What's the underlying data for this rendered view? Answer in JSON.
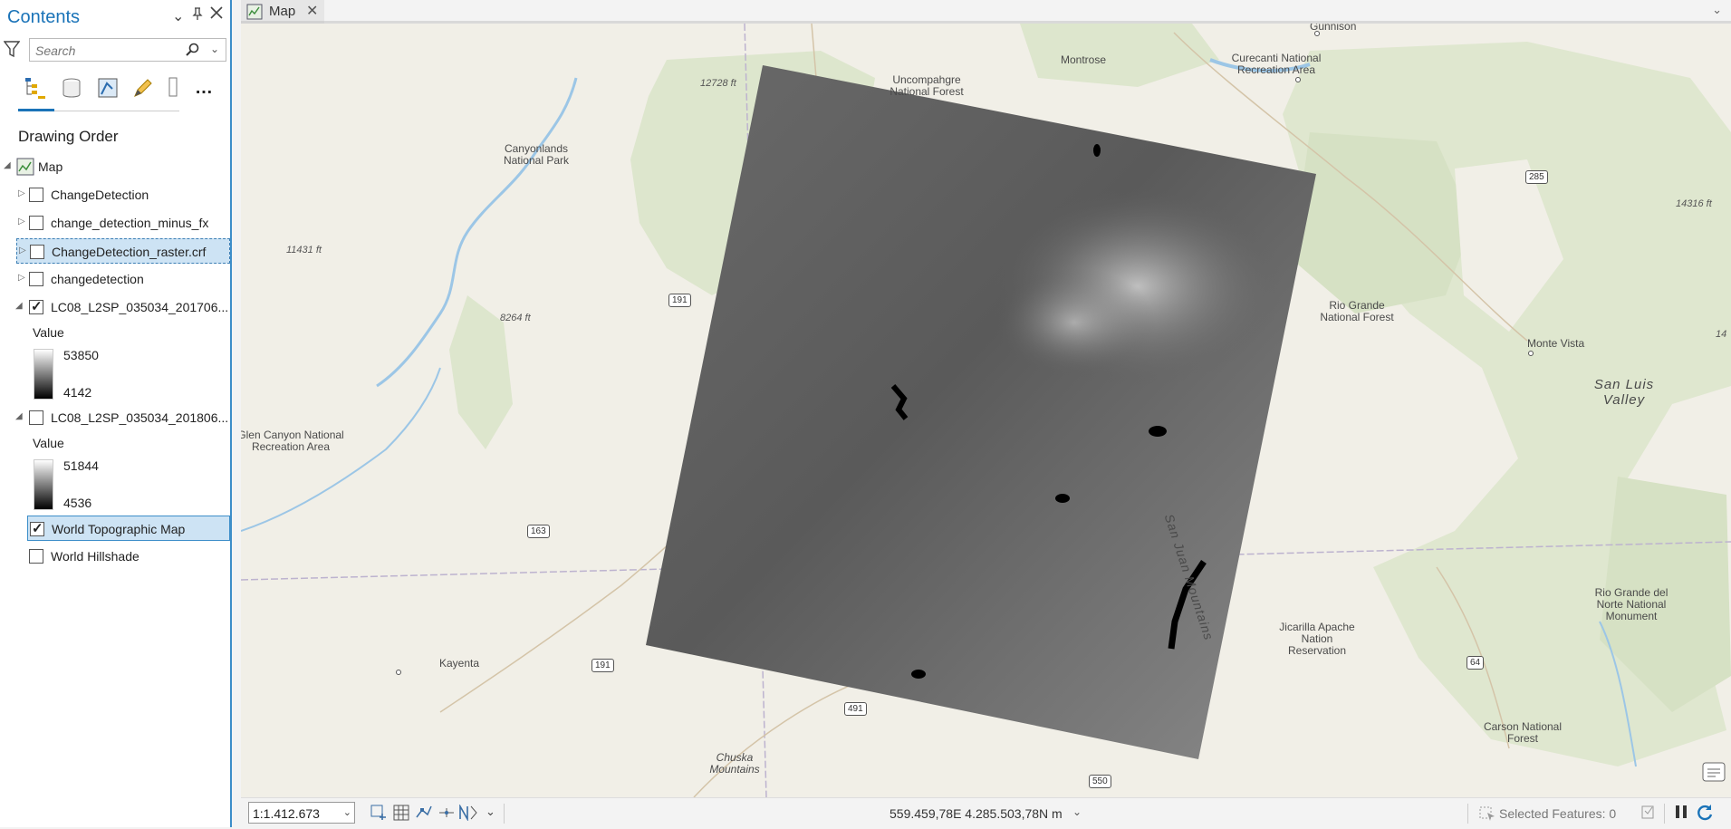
{
  "contents": {
    "title": "Contents",
    "search_placeholder": "Search",
    "section": "Drawing Order",
    "map_label": "Map",
    "layers": [
      {
        "name": "ChangeDetection",
        "checked": false
      },
      {
        "name": "change_detection_minus_fx",
        "checked": false
      },
      {
        "name": "ChangeDetection_raster.crf",
        "checked": false
      },
      {
        "name": "changedetection",
        "checked": false
      },
      {
        "name": "LC08_L2SP_035034_201706...",
        "checked": true,
        "legend_title": "Value",
        "max": "53850",
        "min": "4142"
      },
      {
        "name": "LC08_L2SP_035034_201806...",
        "checked": false,
        "legend_title": "Value",
        "max": "51844",
        "min": "4536"
      },
      {
        "name": "World Topographic Map",
        "checked": true
      },
      {
        "name": "World Hillshade",
        "checked": false
      }
    ]
  },
  "tab": {
    "label": "Map"
  },
  "map": {
    "places": [
      "Gunnison",
      "Montrose",
      "Curecanti National Recreation Area",
      "Uncompahgre National Forest",
      "Canyonlands National Park",
      "Rio Grande National Forest",
      "Monte Vista",
      "San Luis Valley",
      "Glen Canyon National Recreation Area",
      "San Juan Mountains",
      "Jicarilla Apache Nation Reservation",
      "Rio Grande del Norte National Monument",
      "Kayenta",
      "Chuska Mountains",
      "Carson National Forest"
    ],
    "elevations": [
      "12728 ft",
      "11431 ft",
      "8264 ft",
      "14316 ft",
      "14"
    ],
    "routes": [
      "285",
      "191",
      "163",
      "191",
      "491",
      "64",
      "550"
    ]
  },
  "status": {
    "scale": "1:1.412.673",
    "coordinates": "559.459,78E 4.285.503,78N m",
    "selected_features": "Selected Features: 0"
  }
}
